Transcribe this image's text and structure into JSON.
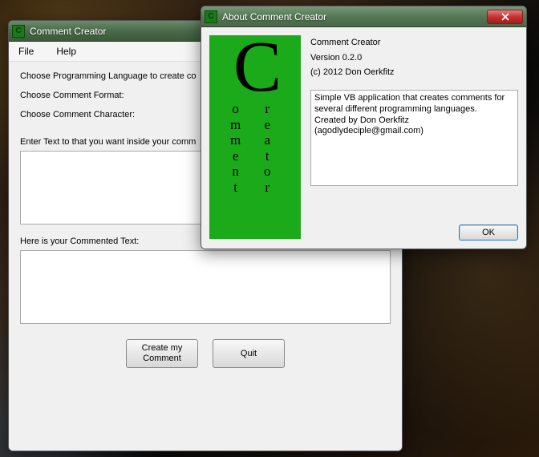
{
  "main": {
    "title": "Comment Creator",
    "menu": {
      "file": "File",
      "help": "Help"
    },
    "labels": {
      "choose_lang": "Choose Programming Language to create co",
      "choose_format": "Choose Comment Format:",
      "choose_char": "Choose Comment Character:",
      "enter_text": "Enter Text to that you want inside your comm",
      "output_label": "Here is your Commented Text:"
    },
    "input_text": "",
    "output_text": "",
    "buttons": {
      "create": "Create my\nComment",
      "quit": "Quit"
    }
  },
  "about": {
    "title": "About Comment Creator",
    "logo": {
      "big": "C",
      "left_word": "omment",
      "right_word": "reator"
    },
    "lines": {
      "name": "Comment Creator",
      "version": "Version 0.2.0",
      "copyright": "(c) 2012 Don Oerkfitz"
    },
    "description": "Simple VB application that creates comments for several different programming languages.\nCreated by Don Oerkfitz (agodlydeciple@gmail.com)",
    "ok": "OK"
  }
}
